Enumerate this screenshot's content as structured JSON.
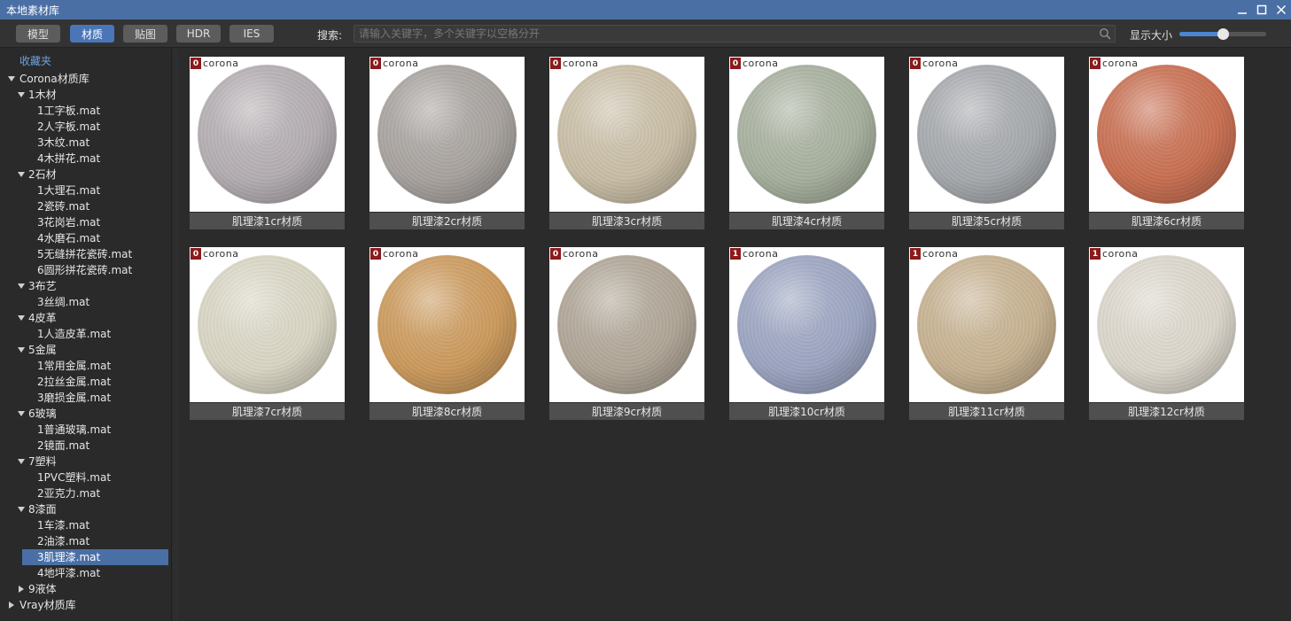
{
  "window": {
    "title": "本地素材库"
  },
  "toolbar": {
    "tabs": [
      {
        "label": "模型",
        "active": false
      },
      {
        "label": "材质",
        "active": true
      },
      {
        "label": "贴图",
        "active": false
      },
      {
        "label": "HDR",
        "active": false
      },
      {
        "label": "IES",
        "active": false
      }
    ],
    "search_label": "搜索:",
    "search_placeholder": "请输入关键字，多个关键字以空格分开",
    "size_label": "显示大小",
    "size_level": 0.5
  },
  "sidebar": {
    "favorites": "收藏夹",
    "tree": [
      {
        "label": "Corona材质库",
        "level": 0,
        "expanded": true
      },
      {
        "label": "1木材",
        "level": 1,
        "expanded": true
      },
      {
        "label": "1工字板.mat",
        "level": 2
      },
      {
        "label": "2人字板.mat",
        "level": 2
      },
      {
        "label": "3木纹.mat",
        "level": 2
      },
      {
        "label": "4木拼花.mat",
        "level": 2
      },
      {
        "label": "2石材",
        "level": 1,
        "expanded": true
      },
      {
        "label": "1大理石.mat",
        "level": 2
      },
      {
        "label": "2瓷砖.mat",
        "level": 2
      },
      {
        "label": "3花岗岩.mat",
        "level": 2
      },
      {
        "label": "4水磨石.mat",
        "level": 2
      },
      {
        "label": "5无缝拼花瓷砖.mat",
        "level": 2
      },
      {
        "label": "6圆形拼花瓷砖.mat",
        "level": 2
      },
      {
        "label": "3布艺",
        "level": 1,
        "expanded": true
      },
      {
        "label": "3丝绸.mat",
        "level": 2
      },
      {
        "label": "4皮革",
        "level": 1,
        "expanded": true
      },
      {
        "label": "1人造皮革.mat",
        "level": 2
      },
      {
        "label": "5金属",
        "level": 1,
        "expanded": true
      },
      {
        "label": "1常用金属.mat",
        "level": 2
      },
      {
        "label": "2拉丝金属.mat",
        "level": 2
      },
      {
        "label": "3磨损金属.mat",
        "level": 2
      },
      {
        "label": "6玻璃",
        "level": 1,
        "expanded": true
      },
      {
        "label": "1普通玻璃.mat",
        "level": 2
      },
      {
        "label": "2镜面.mat",
        "level": 2
      },
      {
        "label": "7塑料",
        "level": 1,
        "expanded": true
      },
      {
        "label": "1PVC塑料.mat",
        "level": 2
      },
      {
        "label": "2亚克力.mat",
        "level": 2
      },
      {
        "label": "8漆面",
        "level": 1,
        "expanded": true
      },
      {
        "label": "1车漆.mat",
        "level": 2
      },
      {
        "label": "2油漆.mat",
        "level": 2
      },
      {
        "label": "3肌理漆.mat",
        "level": 2,
        "selected": true
      },
      {
        "label": "4地坪漆.mat",
        "level": 2
      },
      {
        "label": "9液体",
        "level": 1,
        "expanded": false
      },
      {
        "label": "Vray材质库",
        "level": 0,
        "expanded": false
      }
    ]
  },
  "materials": [
    {
      "name": "肌理漆1cr材质",
      "badge": "0",
      "brand": "corona",
      "color": "#b4aeb2"
    },
    {
      "name": "肌理漆2cr材质",
      "badge": "0",
      "brand": "corona",
      "color": "#a8a39f"
    },
    {
      "name": "肌理漆3cr材质",
      "badge": "0",
      "brand": "corona",
      "color": "#c9bea6"
    },
    {
      "name": "肌理漆4cr材质",
      "badge": "0",
      "brand": "corona",
      "color": "#a7b09e"
    },
    {
      "name": "肌理漆5cr材质",
      "badge": "0",
      "brand": "corona",
      "color": "#a6a9ad"
    },
    {
      "name": "肌理漆6cr材质",
      "badge": "0",
      "brand": "corona",
      "color": "#c96f51"
    },
    {
      "name": "肌理漆7cr材质",
      "badge": "0",
      "brand": "corona",
      "color": "#d9d6c4"
    },
    {
      "name": "肌理漆8cr材质",
      "badge": "0",
      "brand": "corona",
      "color": "#cc9a5c"
    },
    {
      "name": "肌理漆9cr材质",
      "badge": "0",
      "brand": "corona",
      "color": "#b0a697"
    },
    {
      "name": "肌理漆10cr材质",
      "badge": "1",
      "brand": "corona",
      "color": "#9ca5c2"
    },
    {
      "name": "肌理漆11cr材质",
      "badge": "1",
      "brand": "corona",
      "color": "#c7b291"
    },
    {
      "name": "肌理漆12cr材质",
      "badge": "1",
      "brand": "corona",
      "color": "#dcd7cc"
    }
  ]
}
